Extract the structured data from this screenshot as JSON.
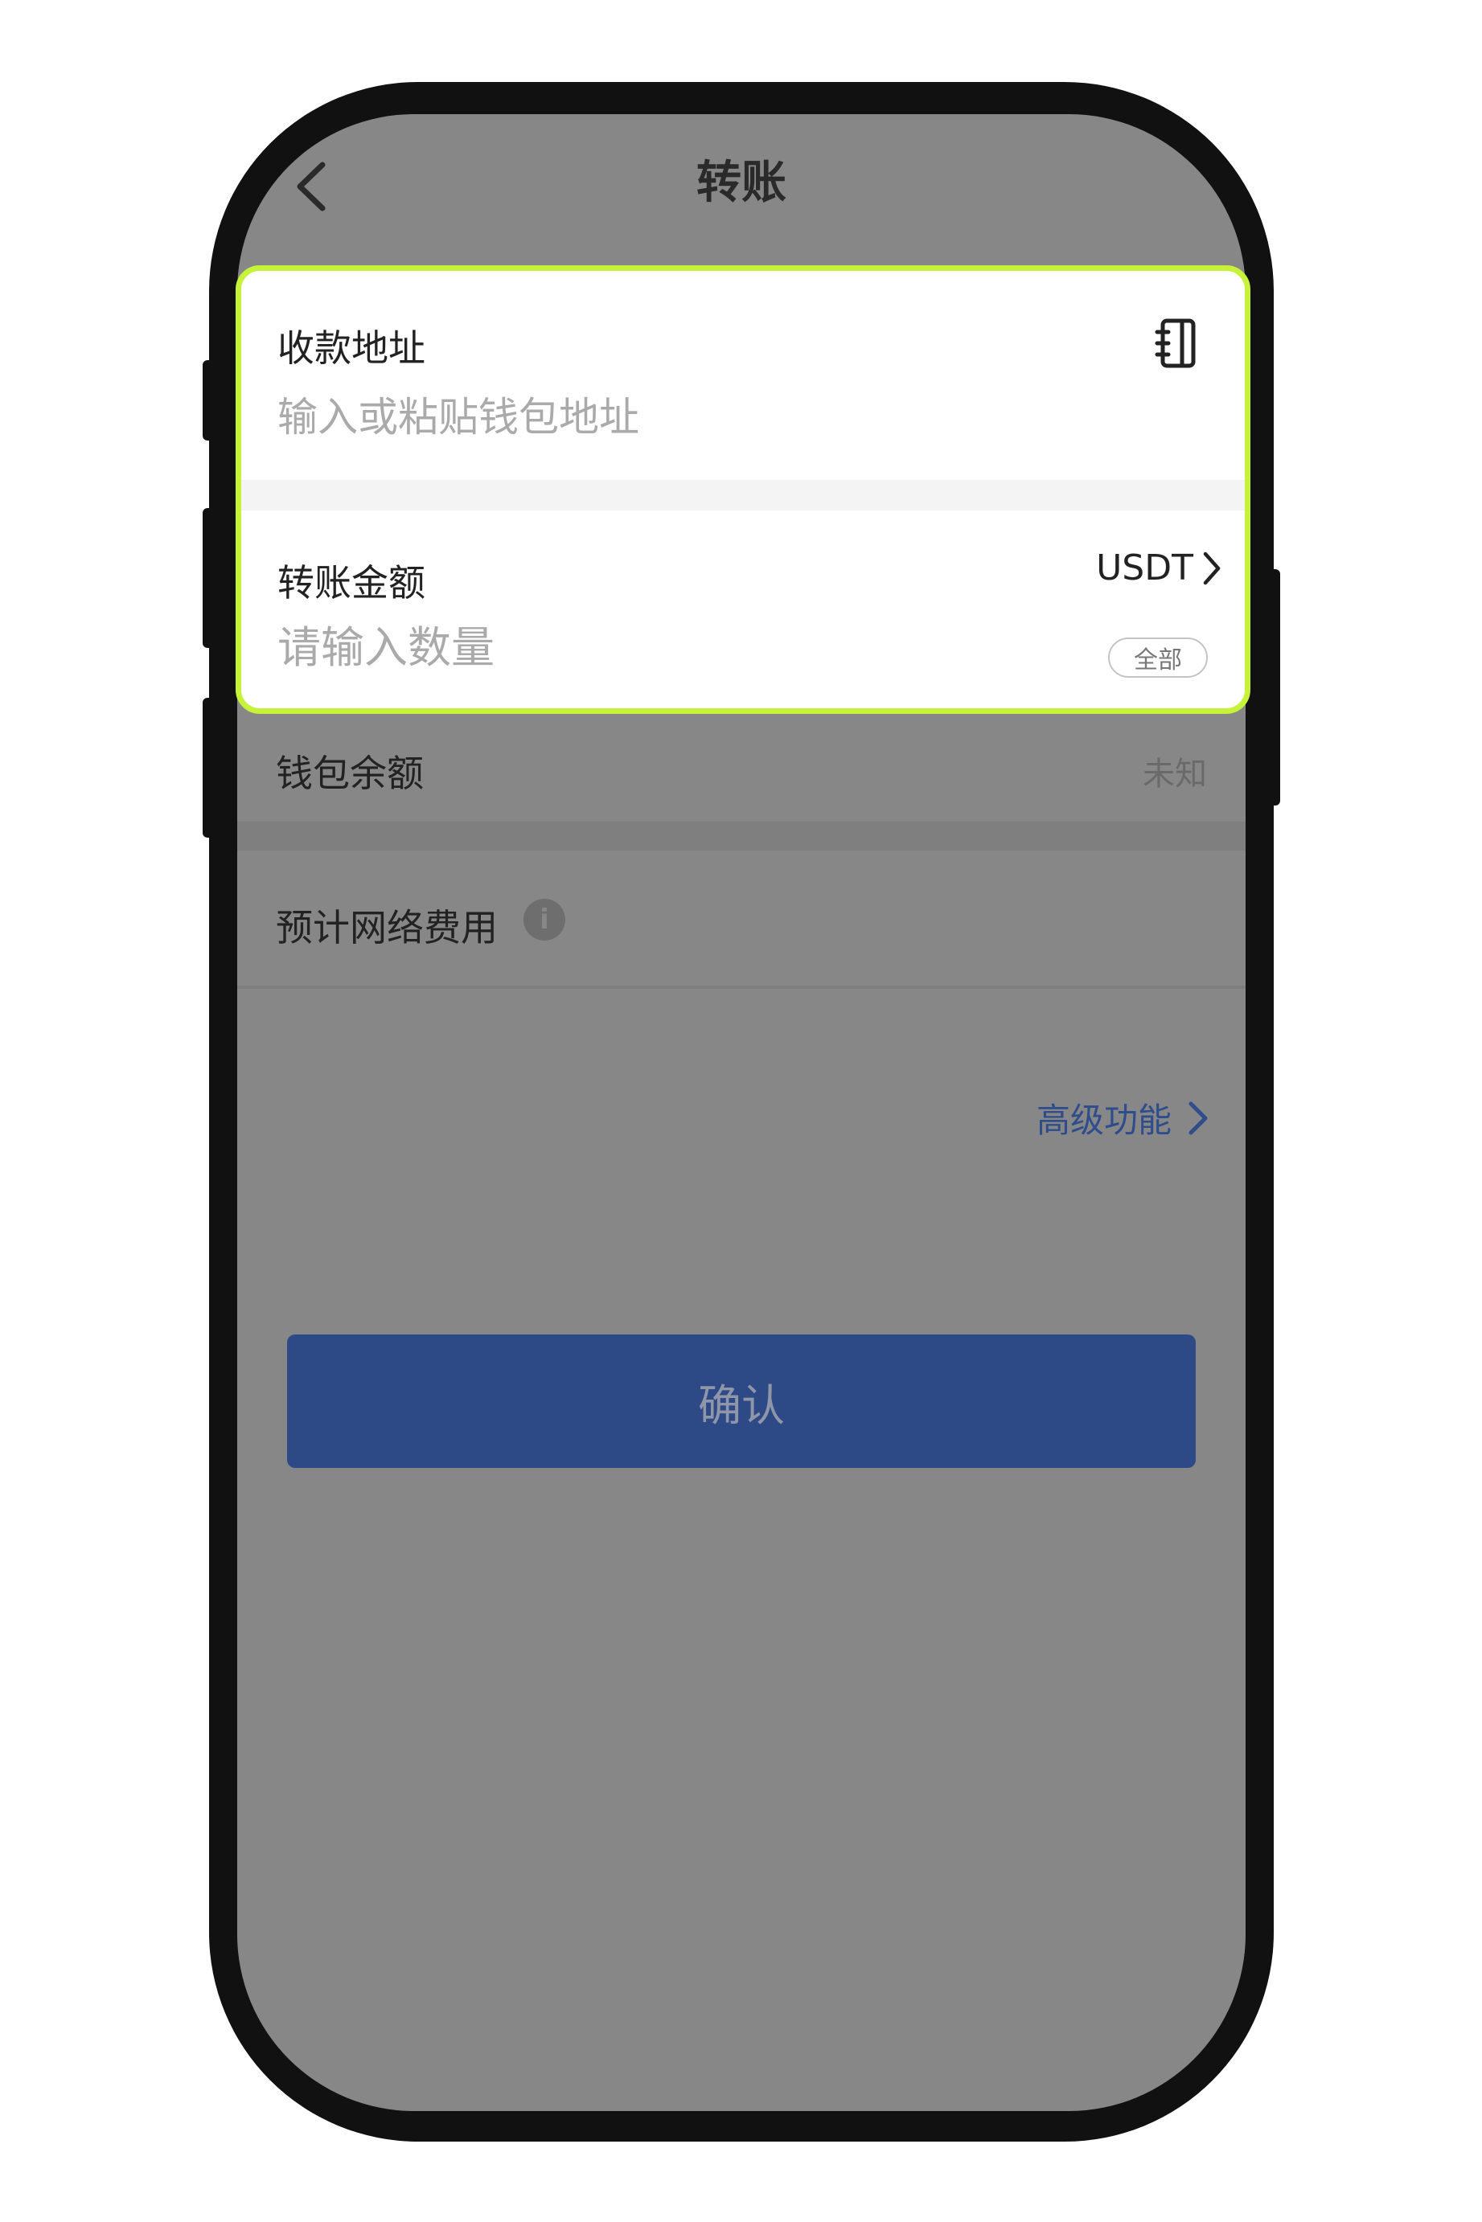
{
  "header": {
    "title": "转账"
  },
  "recipient": {
    "label": "收款地址",
    "placeholder": "输入或粘贴钱包地址"
  },
  "amount": {
    "label": "转账金额",
    "placeholder": "请输入数量",
    "currency": "USDT",
    "all_label": "全部"
  },
  "balance": {
    "label": "钱包余额",
    "value": "未知"
  },
  "fee": {
    "label": "预计网络费用",
    "info_glyph": "i"
  },
  "advanced": {
    "label": "高级功能"
  },
  "confirm": {
    "label": "确认"
  },
  "colors": {
    "highlight_border": "#c6f23a",
    "confirm_button": "#2d4a87",
    "advanced_link": "#2e4d8a",
    "overlay": "#878787"
  }
}
